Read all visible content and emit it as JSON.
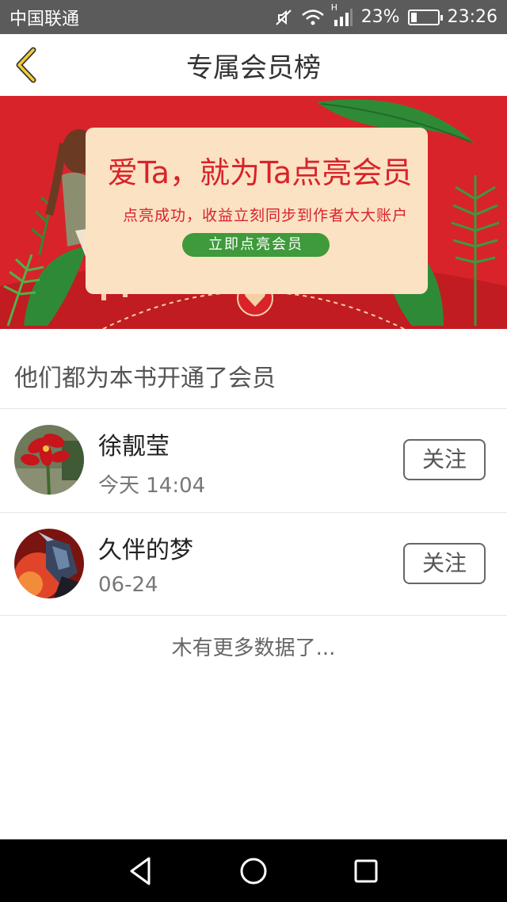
{
  "status_bar": {
    "carrier": "中国联通",
    "network": "H",
    "battery_percent": "23%",
    "battery_level": 0.23,
    "time": "23:26"
  },
  "header": {
    "title": "专属会员榜",
    "back_icon": "chevron-left-icon"
  },
  "banner": {
    "headline": "爱Ta，就为Ta点亮会员",
    "subtitle": "点亮成功，收益立刻同步到作者大大账户",
    "cta_label": "立即点亮会员",
    "colors": {
      "background": "#d8232a",
      "card": "#fbe2c3",
      "cta": "#3e9a3a"
    }
  },
  "section": {
    "title": "他们都为本书开通了会员"
  },
  "members": [
    {
      "name": "徐靓莹",
      "time": "今天 14:04",
      "follow_label": "关注",
      "avatar": "red-flower-avatar"
    },
    {
      "name": "久伴的梦",
      "time": "06-24",
      "follow_label": "关注",
      "avatar": "game-hero-avatar"
    }
  ],
  "footer": {
    "no_more_text": "木有更多数据了..."
  },
  "nav_bar": {
    "icons": [
      "back-triangle-icon",
      "home-circle-icon",
      "recents-square-icon"
    ]
  }
}
